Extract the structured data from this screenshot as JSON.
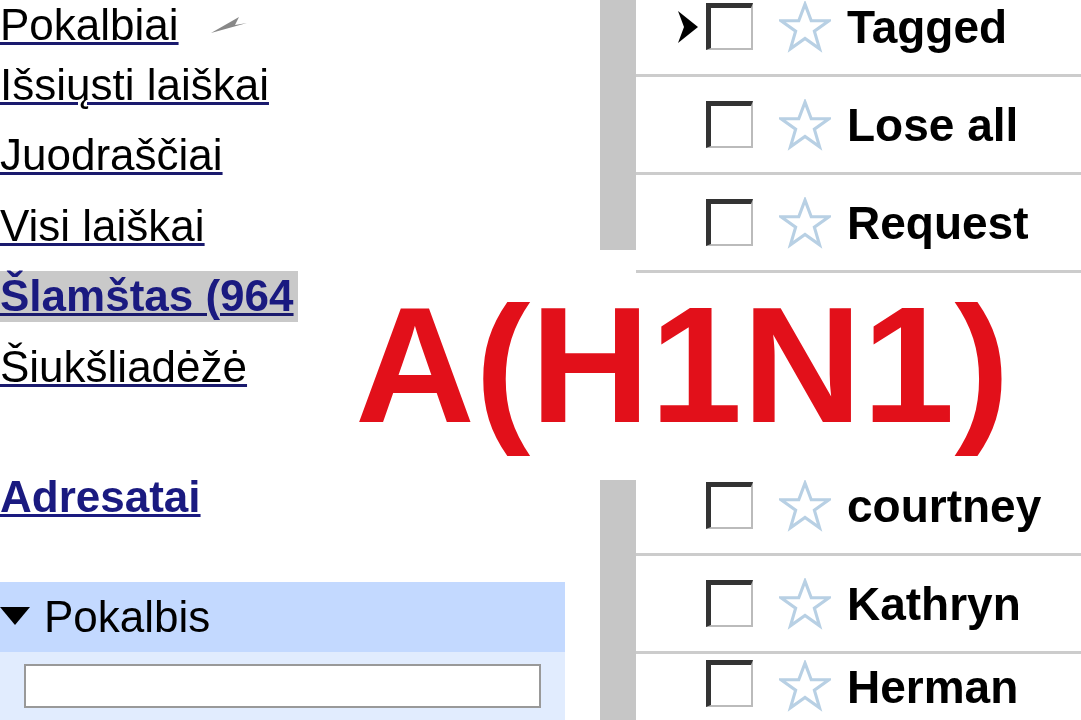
{
  "sidebar": {
    "folders": [
      {
        "label": "Pokalbiai",
        "selected": false
      },
      {
        "label": "Išsiųsti laiškai",
        "selected": false
      },
      {
        "label": "Juodraščiai",
        "selected": false
      },
      {
        "label": "Visi laiškai",
        "selected": false
      },
      {
        "label": "Šlamštas (964",
        "selected": true
      },
      {
        "label": "Šiukšliadėžė",
        "selected": false
      }
    ],
    "contacts_link": "Adresatai",
    "chat_panel": {
      "title": "Pokalbis",
      "expanded": true
    }
  },
  "message_list": {
    "rows": [
      {
        "sender": "Tagged",
        "current": true,
        "checked": false,
        "starred": false
      },
      {
        "sender": "Lose all",
        "current": false,
        "checked": false,
        "starred": false
      },
      {
        "sender": "Request",
        "current": false,
        "checked": false,
        "starred": false
      },
      {
        "kind": "gap"
      },
      {
        "sender": "courtney",
        "current": false,
        "checked": false,
        "starred": false
      },
      {
        "sender": "Kathryn",
        "current": false,
        "checked": false,
        "starred": false
      },
      {
        "sender": "Herman",
        "current": false,
        "checked": false,
        "starred": false
      }
    ]
  },
  "overlay": {
    "headline": "A(H1N1)"
  }
}
